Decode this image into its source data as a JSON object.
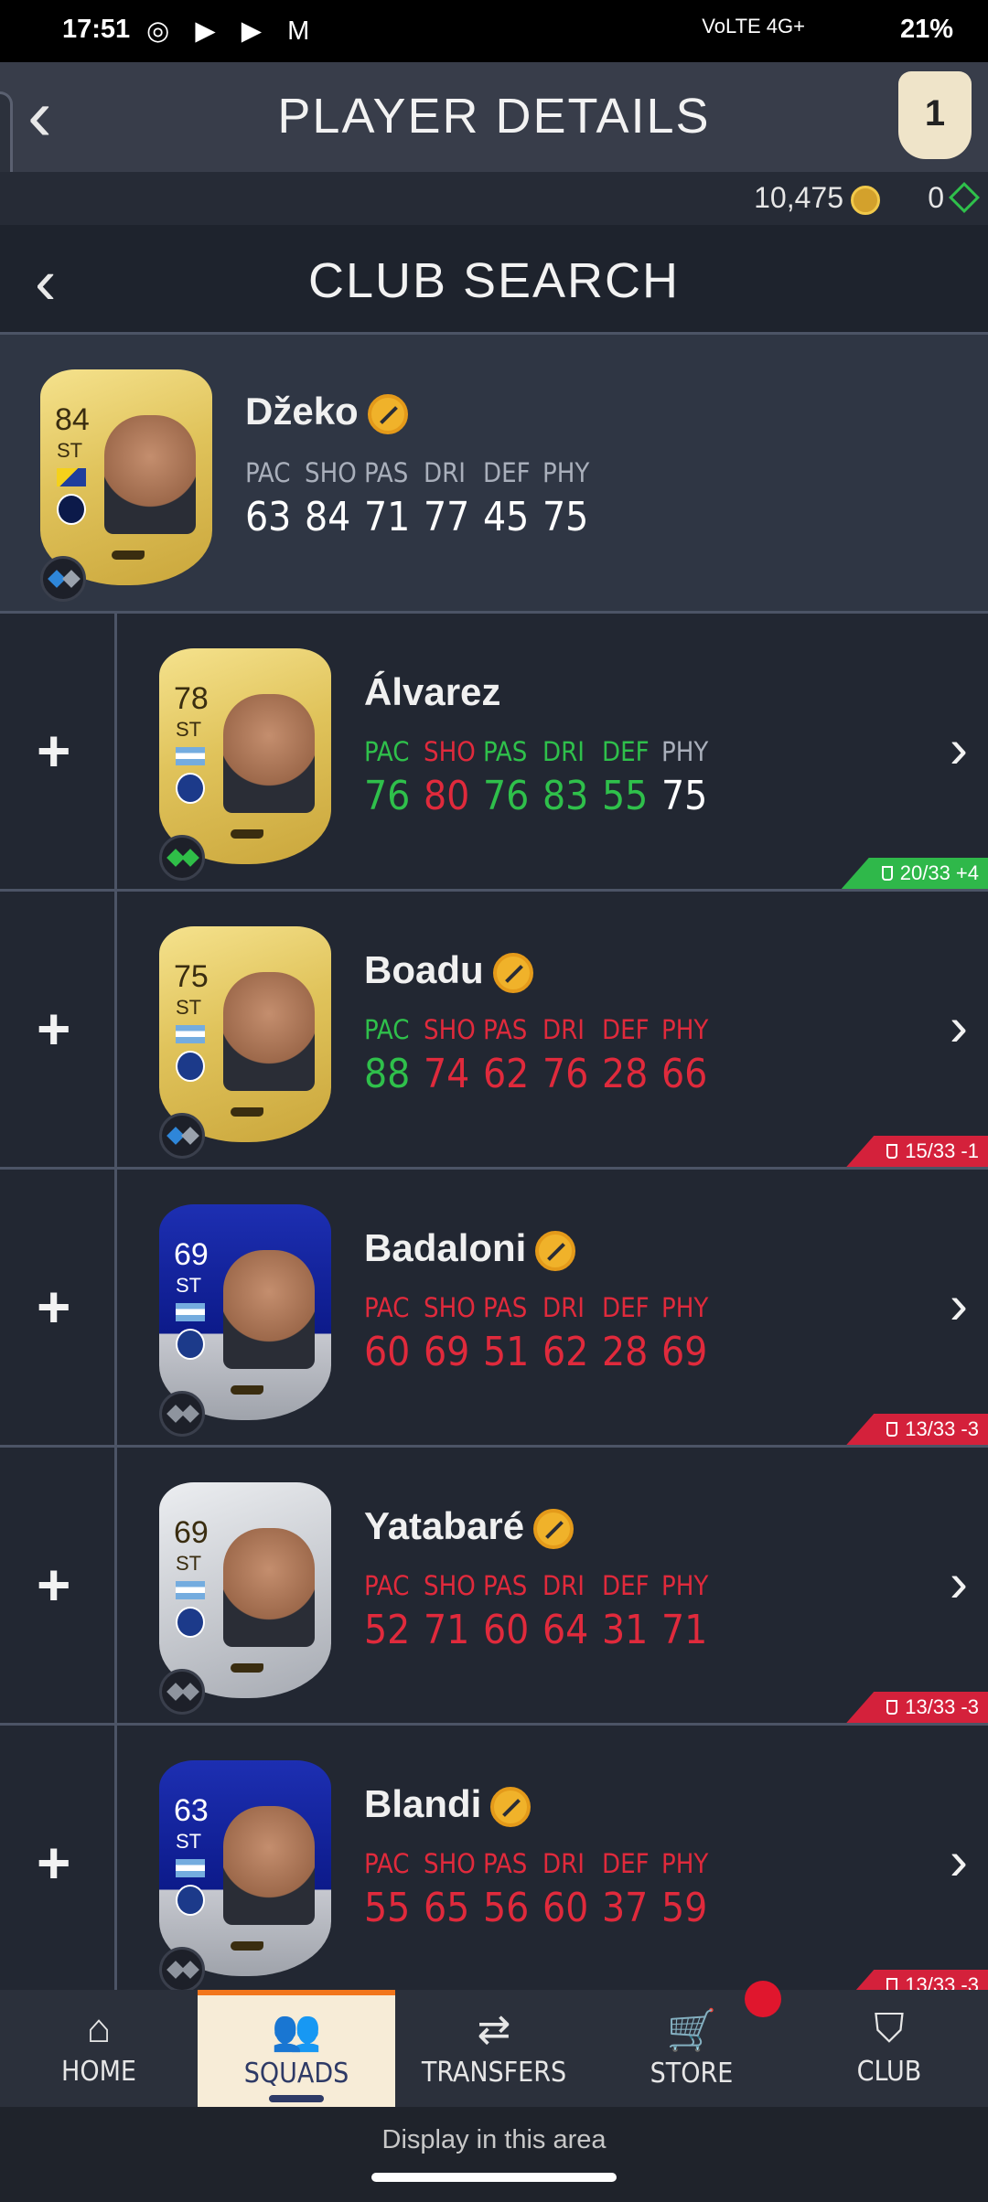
{
  "status": {
    "time": "17:51",
    "apps": "◎ ▶ ▶ M",
    "signal": "VoLTE 4G+",
    "battery": "21%"
  },
  "header": {
    "back_icon": "‹",
    "title": "PLAYER DETAILS",
    "badge": "1"
  },
  "currency": {
    "coins": "10,475",
    "points": "0"
  },
  "subheader": {
    "back_icon": "‹",
    "title": "CLUB SEARCH"
  },
  "current_player": {
    "name": "Džeko",
    "rating": "84",
    "position": "ST",
    "card": "gold",
    "stats": [
      {
        "label": "PAC",
        "value": "63"
      },
      {
        "label": "SHO",
        "value": "84"
      },
      {
        "label": "PAS",
        "value": "71"
      },
      {
        "label": "DRI",
        "value": "77"
      },
      {
        "label": "DEF",
        "value": "45"
      },
      {
        "label": "PHY",
        "value": "75"
      }
    ]
  },
  "results": [
    {
      "name": "Álvarez",
      "rating": "78",
      "position": "ST",
      "card": "gold",
      "untradeable": false,
      "chem": "green",
      "tag": "20/33 +4",
      "tag_color": "g",
      "stats": [
        {
          "label": "PAC",
          "value": "76",
          "delta": "pos"
        },
        {
          "label": "SHO",
          "value": "80",
          "delta": "neg"
        },
        {
          "label": "PAS",
          "value": "76",
          "delta": "pos"
        },
        {
          "label": "DRI",
          "value": "83",
          "delta": "pos"
        },
        {
          "label": "DEF",
          "value": "55",
          "delta": "pos"
        },
        {
          "label": "PHY",
          "value": "75",
          "delta": "neu"
        }
      ]
    },
    {
      "name": "Boadu",
      "rating": "75",
      "position": "ST",
      "card": "gold",
      "untradeable": true,
      "chem": "blue",
      "tag": "15/33 -1",
      "tag_color": "r",
      "stats": [
        {
          "label": "PAC",
          "value": "88",
          "delta": "pos"
        },
        {
          "label": "SHO",
          "value": "74",
          "delta": "neg"
        },
        {
          "label": "PAS",
          "value": "62",
          "delta": "neg"
        },
        {
          "label": "DRI",
          "value": "76",
          "delta": "neg"
        },
        {
          "label": "DEF",
          "value": "28",
          "delta": "neg"
        },
        {
          "label": "PHY",
          "value": "66",
          "delta": "neg"
        }
      ]
    },
    {
      "name": "Badaloni",
      "rating": "69",
      "position": "ST",
      "card": "blue",
      "untradeable": true,
      "chem": "grey",
      "tag": "13/33 -3",
      "tag_color": "r",
      "stats": [
        {
          "label": "PAC",
          "value": "60",
          "delta": "neg"
        },
        {
          "label": "SHO",
          "value": "69",
          "delta": "neg"
        },
        {
          "label": "PAS",
          "value": "51",
          "delta": "neg"
        },
        {
          "label": "DRI",
          "value": "62",
          "delta": "neg"
        },
        {
          "label": "DEF",
          "value": "28",
          "delta": "neg"
        },
        {
          "label": "PHY",
          "value": "69",
          "delta": "neg"
        }
      ]
    },
    {
      "name": "Yatabaré",
      "rating": "69",
      "position": "ST",
      "card": "silver",
      "untradeable": true,
      "chem": "grey",
      "tag": "13/33 -3",
      "tag_color": "r",
      "stats": [
        {
          "label": "PAC",
          "value": "52",
          "delta": "neg"
        },
        {
          "label": "SHO",
          "value": "71",
          "delta": "neg"
        },
        {
          "label": "PAS",
          "value": "60",
          "delta": "neg"
        },
        {
          "label": "DRI",
          "value": "64",
          "delta": "neg"
        },
        {
          "label": "DEF",
          "value": "31",
          "delta": "neg"
        },
        {
          "label": "PHY",
          "value": "71",
          "delta": "neg"
        }
      ]
    },
    {
      "name": "Blandi",
      "rating": "63",
      "position": "ST",
      "card": "blue",
      "untradeable": true,
      "chem": "grey",
      "tag": "13/33 -3",
      "tag_color": "r",
      "stats": [
        {
          "label": "PAC",
          "value": "55",
          "delta": "neg"
        },
        {
          "label": "SHO",
          "value": "65",
          "delta": "neg"
        },
        {
          "label": "PAS",
          "value": "56",
          "delta": "neg"
        },
        {
          "label": "DRI",
          "value": "60",
          "delta": "neg"
        },
        {
          "label": "DEF",
          "value": "37",
          "delta": "neg"
        },
        {
          "label": "PHY",
          "value": "59",
          "delta": "neg"
        }
      ]
    }
  ],
  "nav": [
    {
      "label": "HOME",
      "icon": "⌂",
      "icon_name": "home-icon"
    },
    {
      "label": "SQUADS",
      "icon": "👥",
      "icon_name": "squads-icon",
      "active": true
    },
    {
      "label": "TRANSFERS",
      "icon": "⇄",
      "icon_name": "transfers-icon"
    },
    {
      "label": "STORE",
      "icon": "🛒",
      "icon_name": "store-icon"
    },
    {
      "label": "CLUB",
      "icon": "⛉",
      "icon_name": "club-icon"
    }
  ],
  "ad": {
    "text": "Display in this area"
  }
}
